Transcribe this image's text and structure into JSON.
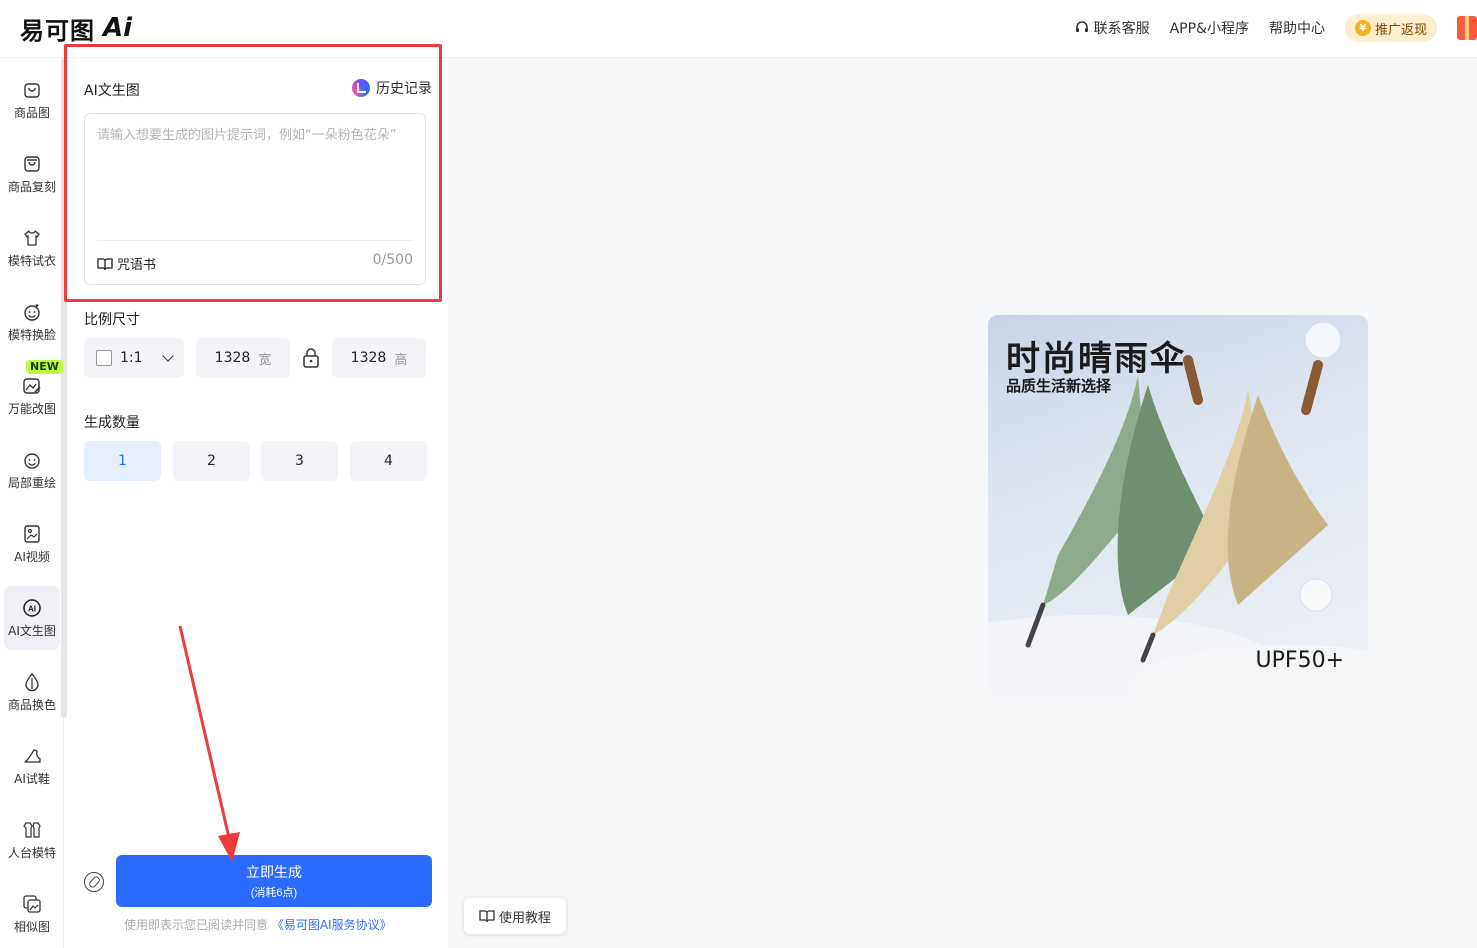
{
  "app": {
    "logo_text": "易可图",
    "logo_ai": "Ai"
  },
  "topnav": {
    "support": "联系客服",
    "app": "APP&小程序",
    "help": "帮助中心",
    "promo": "推广返现"
  },
  "sidebar": {
    "items": [
      {
        "label": "商品图",
        "icon": "bag-icon"
      },
      {
        "label": "商品复刻",
        "icon": "bag-copy-icon"
      },
      {
        "label": "模特试衣",
        "icon": "shirt-icon"
      },
      {
        "label": "模特换脸",
        "icon": "face-icon"
      },
      {
        "label": "万能改图",
        "icon": "image-edit-icon"
      },
      {
        "label": "局部重绘",
        "icon": "face-paint-icon"
      },
      {
        "label": "AI视频",
        "icon": "video-icon"
      },
      {
        "label": "AI文生图",
        "icon": "ai-circle-icon"
      },
      {
        "label": "商品换色",
        "icon": "drop-icon"
      },
      {
        "label": "AI试鞋",
        "icon": "shoe-icon"
      },
      {
        "label": "人台模特",
        "icon": "mannequin-icon"
      },
      {
        "label": "相似图",
        "icon": "similar-image-icon"
      }
    ],
    "new_badge": "NEW",
    "active": "AI文生图",
    "accent": "#b8ff3a"
  },
  "panel": {
    "title": "AI文生图",
    "history": "历史记录",
    "prompt_placeholder": "请输入想要生成的图片提示词，例如“一朵粉色花朵”",
    "prompt_value": "",
    "spellbook": "咒语书",
    "counter": "0/500",
    "ratio_title": "比例尺寸",
    "ratio_value": "1:1",
    "width_value": "1328",
    "width_unit": "宽",
    "height_value": "1328",
    "height_unit": "高",
    "count_title": "生成数量",
    "counts": [
      "1",
      "2",
      "3",
      "4"
    ],
    "selected_count": "1",
    "generate_label": "立即生成",
    "generate_cost": "(消耗6点)",
    "agree_prefix": "使用即表示您已阅读并同意",
    "agree_link": "《易可图AI服务协议》"
  },
  "main": {
    "preview_title": "时尚晴雨伞",
    "preview_subtitle": "品质生活新选择",
    "preview_badge": "UPF50+",
    "tutorial": "使用教程"
  },
  "colors": {
    "primary": "#2b6bff",
    "highlight_frame": "#ee3b3b"
  }
}
